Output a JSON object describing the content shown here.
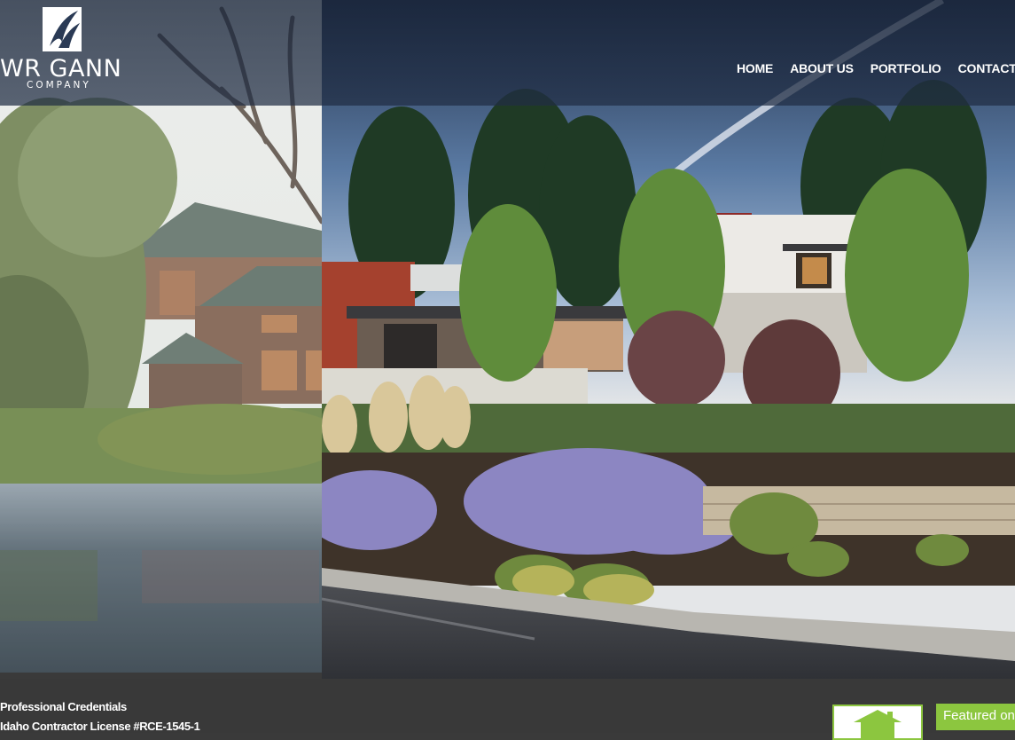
{
  "brand": {
    "name": "WR GANN",
    "subtitle": "COMPANY",
    "logo_icon": "wr-gann-swoosh-logo"
  },
  "nav": {
    "items": [
      {
        "label": "HOME"
      },
      {
        "label": "ABOUT US"
      },
      {
        "label": "PORTFOLIO"
      },
      {
        "label": "CONTACT US"
      }
    ]
  },
  "footer": {
    "credentials_title": "Professional Credentials",
    "license": "Idaho Contractor License #RCE-1545-1",
    "badge_icon": "house-icon",
    "featured_label": "Featured on"
  },
  "colors": {
    "header_bg": "#1f2d45",
    "footer_bg": "#393939",
    "badge_green": "#8cc63f"
  }
}
